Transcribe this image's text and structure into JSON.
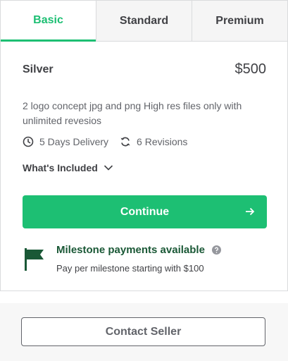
{
  "tabs": [
    {
      "label": "Basic",
      "active": true
    },
    {
      "label": "Standard",
      "active": false
    },
    {
      "label": "Premium",
      "active": false
    }
  ],
  "package": {
    "name": "Silver",
    "price": "$500",
    "description": "2 logo concept jpg and png High res files only with unlimited revesios",
    "delivery": "5 Days Delivery",
    "revisions": "6 Revisions",
    "whats_included": "What's Included"
  },
  "continue_label": "Continue",
  "milestone": {
    "title": "Milestone payments available",
    "subtitle": "Pay per milestone starting with $100"
  },
  "contact_label": "Contact Seller",
  "colors": {
    "accent": "#1dbf73",
    "milestone_title": "#1a5836",
    "flag": "#1a5836",
    "text": "#404145",
    "muted": "#62646a"
  },
  "icons": {
    "delivery": "clock-icon",
    "revisions": "refresh-icon",
    "included_toggle": "chevron-down-icon",
    "continue": "arrow-right-icon",
    "milestone": "flag-icon",
    "milestone_help": "question-circle-icon"
  }
}
